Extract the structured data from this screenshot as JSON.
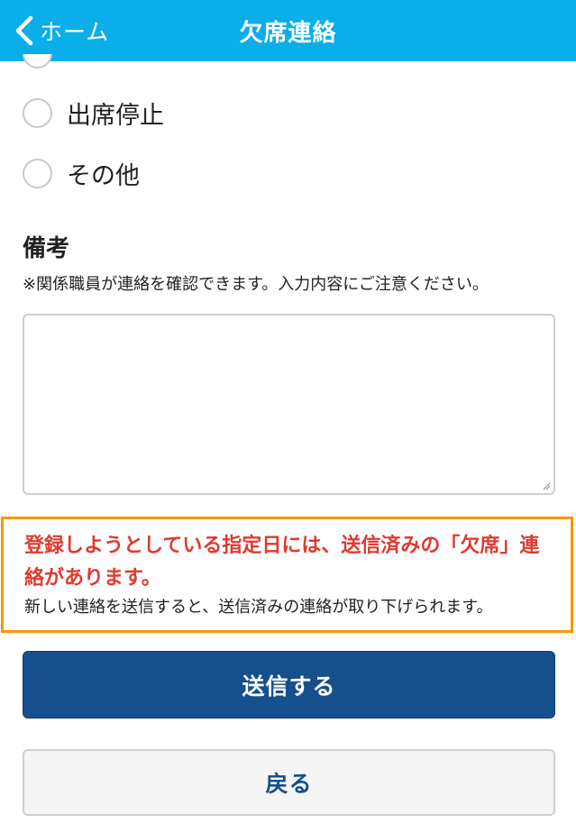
{
  "header": {
    "back_label": "ホーム",
    "title": "欠席連絡",
    "color": "#0aaee8"
  },
  "options": [
    {
      "label": "出席停止",
      "selected": false
    },
    {
      "label": "その他",
      "selected": false
    }
  ],
  "remarks": {
    "title": "備考",
    "note": "※関係職員が連絡を確認できます。入力内容にご注意ください。",
    "value": ""
  },
  "warning": {
    "main": "登録しようとしている指定日には、送信済みの「欠席」連絡があります。",
    "sub": "新しい連絡を送信すると、送信済みの連絡が取り下げられます。",
    "border_color": "#f7960d",
    "text_color": "#e03a2f"
  },
  "buttons": {
    "submit_label": "送信する",
    "back_label": "戻る",
    "submit_color": "#164f8e"
  }
}
